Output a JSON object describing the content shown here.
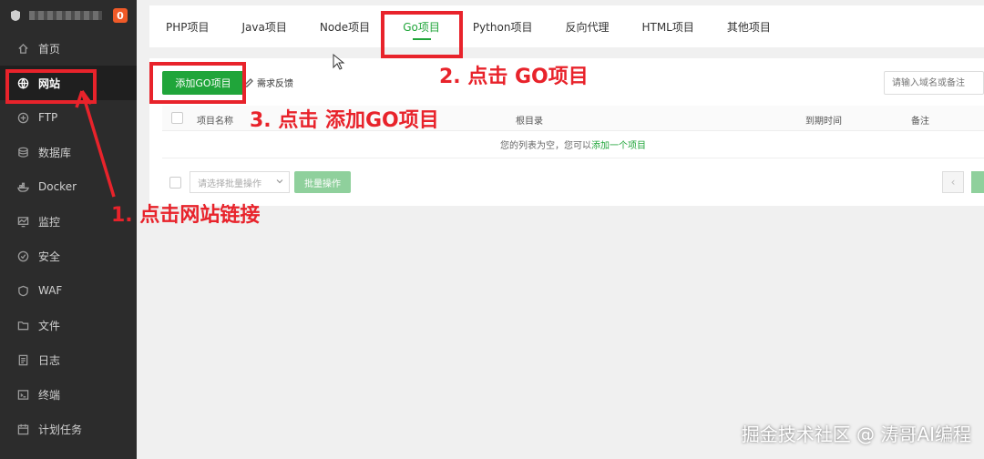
{
  "sidebar": {
    "badge": "0",
    "items": [
      {
        "label": "首页",
        "icon": "home-icon"
      },
      {
        "label": "网站",
        "icon": "globe-icon",
        "active": true
      },
      {
        "label": "FTP",
        "icon": "ftp-icon"
      },
      {
        "label": "数据库",
        "icon": "database-icon"
      },
      {
        "label": "Docker",
        "icon": "docker-icon"
      },
      {
        "label": "监控",
        "icon": "monitor-icon"
      },
      {
        "label": "安全",
        "icon": "shield-icon"
      },
      {
        "label": "WAF",
        "icon": "waf-icon"
      },
      {
        "label": "文件",
        "icon": "folder-icon"
      },
      {
        "label": "日志",
        "icon": "log-icon"
      },
      {
        "label": "终端",
        "icon": "terminal-icon"
      },
      {
        "label": "计划任务",
        "icon": "schedule-icon"
      }
    ]
  },
  "tabs": [
    {
      "label": "PHP项目"
    },
    {
      "label": "Java项目"
    },
    {
      "label": "Node项目"
    },
    {
      "label": "Go项目",
      "active": true
    },
    {
      "label": "Python项目"
    },
    {
      "label": "反向代理"
    },
    {
      "label": "HTML项目"
    },
    {
      "label": "其他项目"
    }
  ],
  "toolbar": {
    "add_label": "添加GO项目",
    "feedback_label": "需求反馈",
    "search_placeholder": "请输入域名或备注"
  },
  "table": {
    "columns": [
      "项目名称",
      "根目录",
      "到期时间",
      "备注"
    ],
    "empty_text": "您的列表为空，您可以",
    "empty_link": "添加一个项目"
  },
  "batch": {
    "select_placeholder": "请选择批量操作",
    "button_label": "批量操作",
    "prev_label": "‹"
  },
  "annotations": {
    "step1": "1. 点击网站链接",
    "step2": "2. 点击 GO项目",
    "step3": "3. 点击 添加GO项目",
    "color": "#e8232b"
  },
  "watermark": "掘金技术社区 @ 涛哥AI编程",
  "colors": {
    "accent": "#20a53a",
    "sidebar": "#2c2c2c"
  }
}
